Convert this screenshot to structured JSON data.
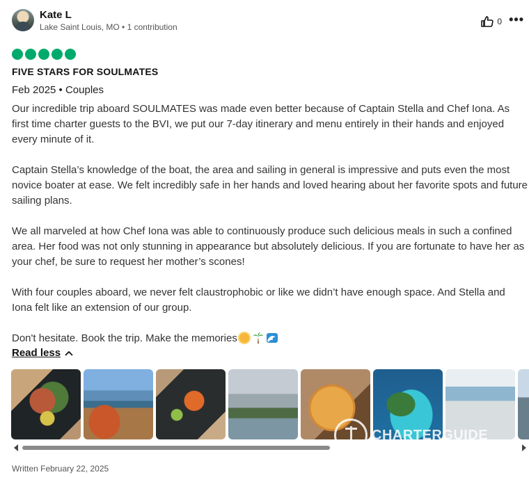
{
  "reviewer": {
    "name": "Kate L",
    "location_contributions": "Lake Saint Louis, MO • 1 contribution"
  },
  "actions": {
    "helpful_count": "0",
    "more_label": "•••"
  },
  "review": {
    "rating": 5,
    "title": "FIVE STARS FOR SOULMATES",
    "trip_meta": "Feb 2025 • Couples",
    "paragraphs": {
      "p1": "Our incredible trip aboard SOULMATES was made even better because of Captain Stella and Chef Iona. As first time charter guests to the BVI, we put our 7-day itinerary and menu entirely in their hands and enjoyed every minute of it.",
      "p2": "Captain Stella’s knowledge of the boat, the area and sailing in general is impressive and puts even the most novice boater at ease. We felt incredibly safe in her hands and loved hearing about her favorite spots and future sailing plans.",
      "p3": "We all marveled at how Chef Iona was able to continuously produce such delicious meals in such a confined area. Her food was not only stunning in appearance but absolutely delicious. If you are fortunate to have her as your chef, be sure to request her mother’s scones!",
      "p4": "With four couples aboard, we never felt claustrophobic or like we didn’t have enough space. And Stella and Iona felt like an extension of our group.",
      "p5": "Don't hesitate. Book the trip. Make the memories"
    },
    "emojis": [
      "sun-emoji",
      "palm-tree-emoji",
      "wave-emoji"
    ],
    "read_less_label": "Read less",
    "written_date": "Written February 22, 2025"
  },
  "gallery": {
    "photos": [
      "salad-plate-photo",
      "drink-harbor-photo",
      "plated-dish-photo",
      "rainbow-anchorage-photo",
      "soup-bowl-photo",
      "aerial-bay-photo",
      "catamaran-deck-photo",
      "partial-photo"
    ],
    "watermark_text": "CHARTERGUIDE"
  },
  "colors": {
    "rating_bubble": "#00aa6c",
    "scrollbar_thumb": "#8a8a8a"
  }
}
